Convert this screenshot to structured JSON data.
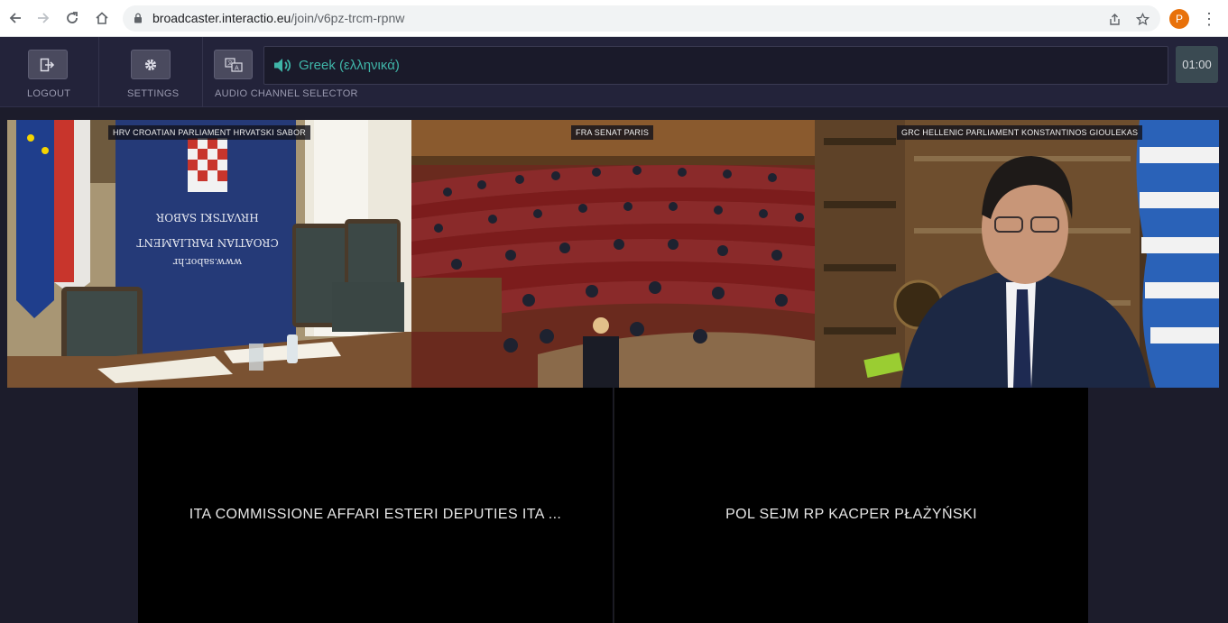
{
  "browser": {
    "url_host": "broadcaster.interactio.eu",
    "url_path": "/join/v6pz-trcm-rpnw",
    "profile_initial": "P"
  },
  "toolbar": {
    "logout_label": "LOGOUT",
    "settings_label": "SETTINGS",
    "audio_channel_label": "AUDIO CHANNEL SELECTOR",
    "selected_language": "Greek (ελληνικά)",
    "timer": "01:00"
  },
  "videos": [
    {
      "label": "HRV CROATIAN PARLIAMENT HRVATSKI SABOR"
    },
    {
      "label": "FRA SENAT PARIS"
    },
    {
      "label": "GRC HELLENIC PARLIAMENT KONSTANTINOS GIOULEKAS"
    }
  ],
  "placeholders": [
    {
      "name": "ITA COMMISSIONE AFFARI ESTERI DEPUTIES ITA ..."
    },
    {
      "name": "POL SEJM RP KACPER PŁAŻYŃSKI"
    }
  ],
  "banner_text": {
    "line1": "HRVATSKI SABOR",
    "line2": "CROATIAN PARLIAMENT",
    "line3": "www.sabor.hr"
  },
  "colors": {
    "accent": "#3fb5a8",
    "toolbar_bg": "#23233a",
    "stage_bg": "#1c1c2b"
  }
}
